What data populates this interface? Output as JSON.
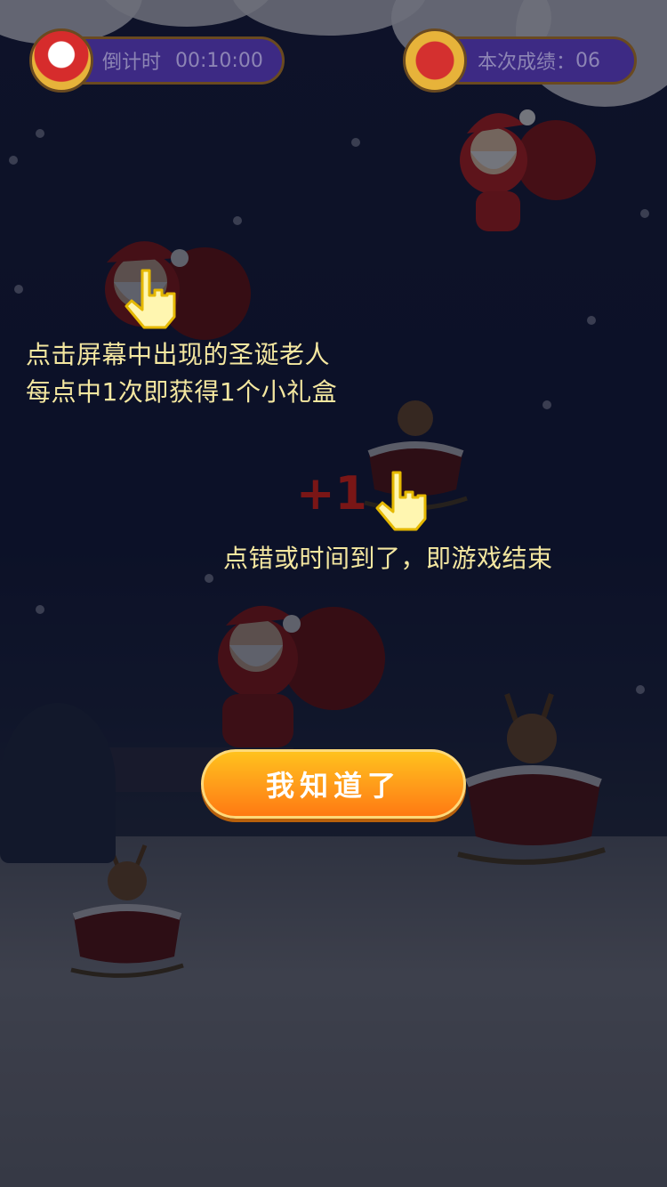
{
  "hud": {
    "countdown_label": "倒计时",
    "countdown_value": "00:10:00",
    "score_label": "本次成绩：",
    "score_value": "06"
  },
  "tutorial": {
    "tip_tap_line1": "点击屏幕中出现的圣诞老人",
    "tip_tap_line2": "每点中1次即获得1个小礼盒",
    "tip_end": "点错或时间到了，即游戏结束",
    "plus_one": "+1"
  },
  "button": {
    "confirm_label": "我知道了"
  },
  "colors": {
    "tip_text": "#f4e7a0",
    "button_top": "#ffc21d",
    "button_bottom": "#ff7a12",
    "hud_pill": "#3d2a84"
  }
}
